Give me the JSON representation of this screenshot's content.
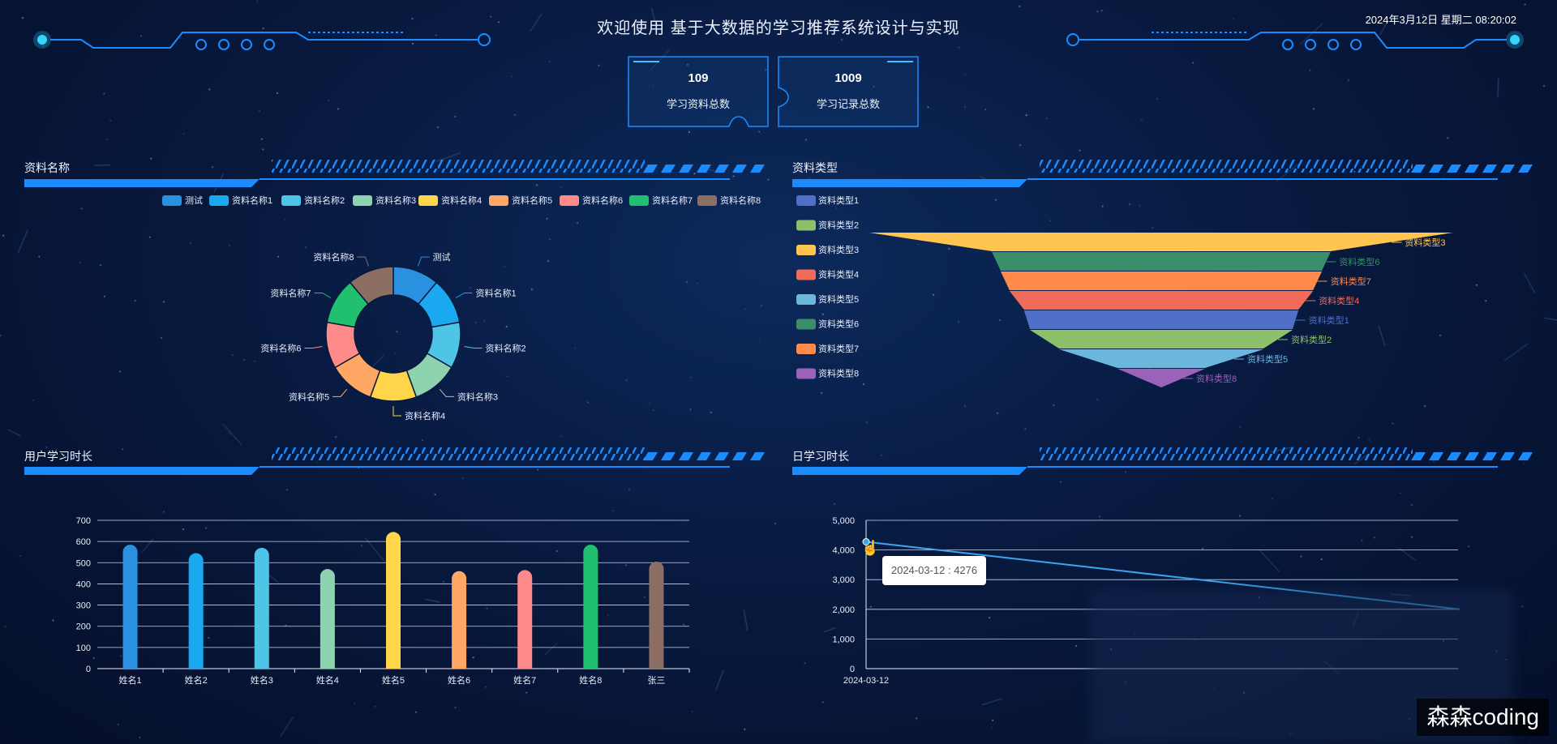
{
  "header": {
    "title": "欢迎使用 基于大数据的学习推荐系统设计与实现",
    "datetime": "2024年3月12日 星期二 08:20:02"
  },
  "stats": [
    {
      "value": "109",
      "label": "学习资料总数"
    },
    {
      "value": "1009",
      "label": "学习记录总数"
    }
  ],
  "panels": {
    "material_name": {
      "title": "资料名称"
    },
    "material_type": {
      "title": "资料类型"
    },
    "user_study_time": {
      "title": "用户学习时长"
    },
    "daily_study_time": {
      "title": "日学习时长"
    }
  },
  "colors": {
    "accent": "#1a8cff",
    "palette": [
      "#2a90e0",
      "#1aa8f0",
      "#4ec4e6",
      "#8ed3b0",
      "#ffd54a",
      "#ffa866",
      "#ff8a8a",
      "#20c070",
      "#8d6e63"
    ],
    "funnel": {
      "t1": "#5070c8",
      "t2": "#8dc06a",
      "t3": "#ffc550",
      "t4": "#f06b5a",
      "t5": "#6bb7de",
      "t6": "#3a8f6a",
      "t7": "#ff8a4a",
      "t8": "#9a62b8"
    }
  },
  "chart_data": [
    {
      "type": "pie",
      "title": "资料名称",
      "labels": [
        "测试",
        "资料名称1",
        "资料名称2",
        "资料名称3",
        "资料名称4",
        "资料名称5",
        "资料名称6",
        "资料名称7",
        "资料名称8"
      ],
      "values": [
        1,
        1,
        1,
        1,
        1,
        1,
        1,
        1,
        1
      ]
    },
    {
      "type": "funnel",
      "title": "资料类型",
      "legend": [
        "资料类型1",
        "资料类型2",
        "资料类型3",
        "资料类型4",
        "资料类型5",
        "资料类型6",
        "资料类型7",
        "资料类型8"
      ],
      "order_top_to_bottom": [
        "资料类型3",
        "资料类型6",
        "资料类型7",
        "资料类型4",
        "资料类型1",
        "资料类型2",
        "资料类型5",
        "资料类型8"
      ],
      "relative_size": [
        1.0,
        0.58,
        0.55,
        0.52,
        0.47,
        0.45,
        0.35,
        0.15
      ]
    },
    {
      "type": "bar",
      "title": "用户学习时长",
      "categories": [
        "姓名1",
        "姓名2",
        "姓名3",
        "姓名4",
        "姓名5",
        "姓名6",
        "姓名7",
        "姓名8",
        "张三"
      ],
      "values": [
        585,
        545,
        570,
        470,
        645,
        460,
        465,
        585,
        505
      ],
      "ylim": [
        0,
        700
      ],
      "yticks": [
        0,
        100,
        200,
        300,
        400,
        500,
        600,
        700
      ]
    },
    {
      "type": "line",
      "title": "日学习时长",
      "x": [
        "2024-03-12"
      ],
      "values": [
        4276
      ],
      "ylim": [
        0,
        5000
      ],
      "yticks": [
        "0",
        "1,000",
        "2,000",
        "3,000",
        "4,000",
        "5,000"
      ],
      "tooltip": "2024-03-12 : 4276"
    }
  ],
  "watermark": "森森coding"
}
